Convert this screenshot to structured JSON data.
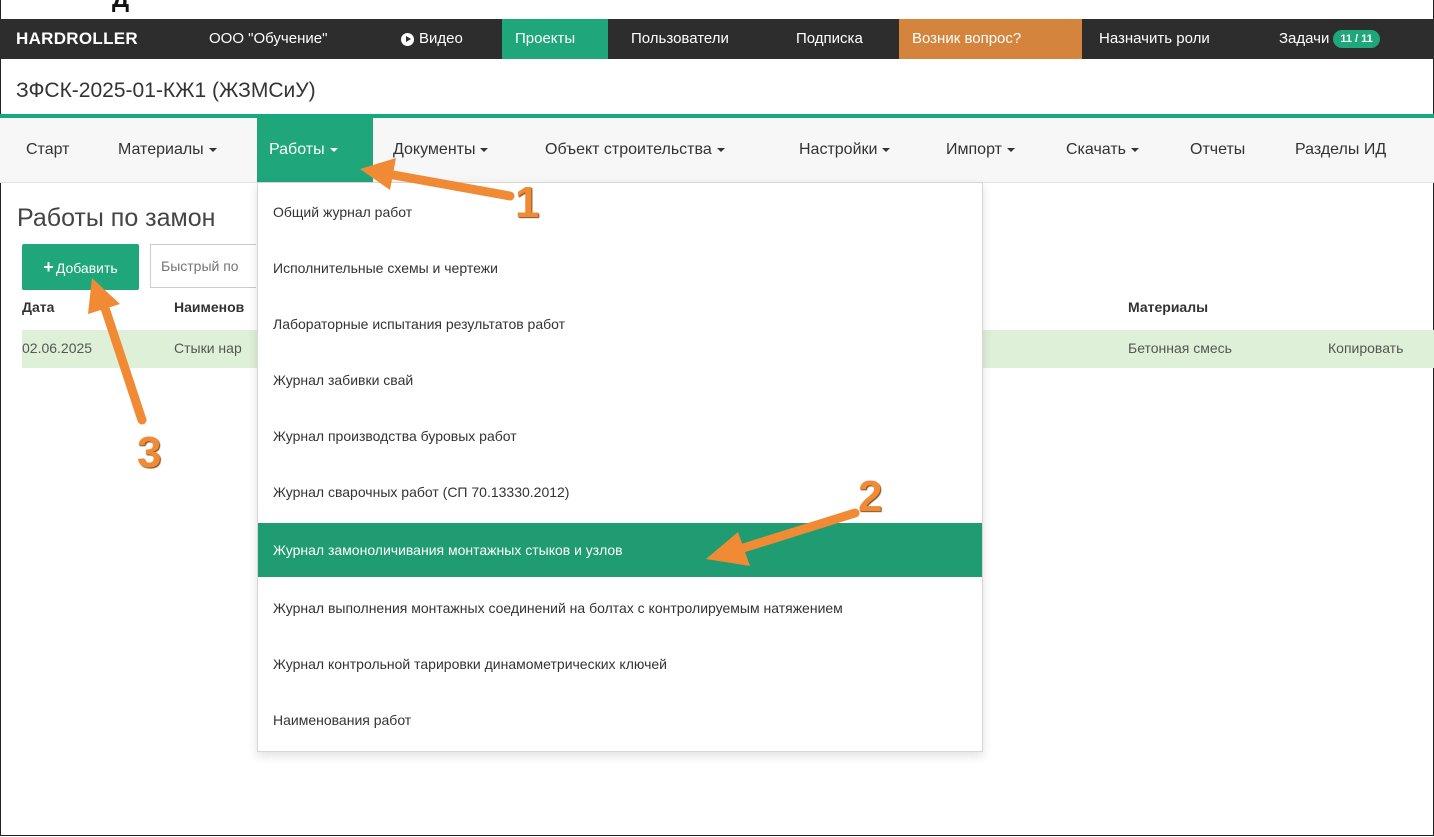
{
  "caption": "Д",
  "topbar": {
    "brand": "HARDROLLER",
    "org": "ООО \"Обучение\"",
    "video": "Видео",
    "projects": "Проекты",
    "users": "Пользователи",
    "subscription": "Подписка",
    "question": "Возник вопрос?",
    "assign_roles": "Назначить роли",
    "tasks": "Задачи",
    "tasks_badge": "11 / 11",
    "colors": {
      "bar": "#2d2d2d",
      "active": "#1fa67a",
      "question": "#d4843c"
    }
  },
  "project_title": "ЗФСК-2025-01-КЖ1 (ЖЗМСиУ)",
  "nav": {
    "start": "Старт",
    "materials": "Материалы",
    "works": "Работы",
    "documents": "Документы",
    "object": "Объект строительства",
    "settings": "Настройки",
    "import": "Импорт",
    "download": "Скачать",
    "reports": "Отчеты",
    "id_sections": "Разделы ИД"
  },
  "page": {
    "title": "Работы по замон",
    "add_label": "Добавить",
    "search_placeholder": "Быстрый по"
  },
  "table": {
    "headers": {
      "date": "Дата",
      "name": "Наименов",
      "materials": "Материалы"
    },
    "rows": [
      {
        "date": "02.06.2025",
        "name": "Стыки нар",
        "materials": "Бетонная смесь",
        "action": "Копировать"
      }
    ]
  },
  "dropdown": {
    "items": [
      "Общий журнал работ",
      "Исполнительные схемы и чертежи",
      "Лабораторные испытания результатов работ",
      "Журнал забивки свай",
      "Журнал производства буровых работ",
      "Журнал сварочных работ (СП 70.13330.2012)",
      "Журнал замоноличивания монтажных стыков и узлов",
      "Журнал выполнения монтажных соединений на болтах с контролируемым натяжением",
      "Журнал контрольной тарировки динамометрических ключей",
      "Наименования работ"
    ],
    "highlighted_index": 6
  },
  "annotations": {
    "step1": "1",
    "step2": "2",
    "step3": "3",
    "color": "#f08a35"
  }
}
